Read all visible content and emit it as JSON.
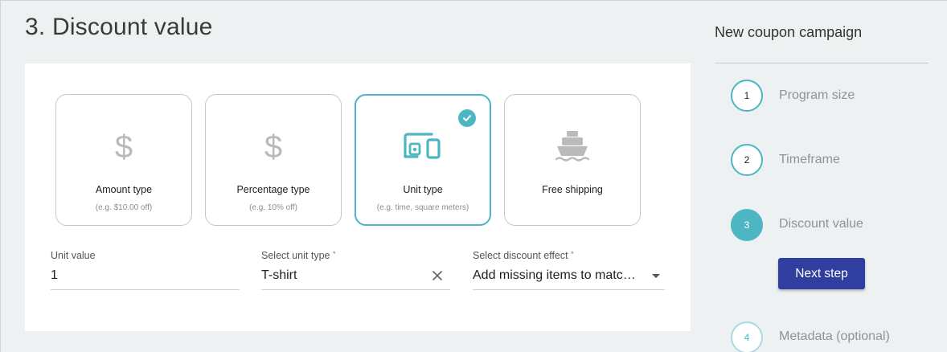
{
  "page": {
    "title": "3. Discount value"
  },
  "cards": [
    {
      "id": "amount",
      "icon": "dollar-icon",
      "glyph": "$",
      "title": "Amount type",
      "subtitle": "(e.g. $10.00 off)",
      "selected": false
    },
    {
      "id": "percentage",
      "icon": "dollar-icon",
      "glyph": "$",
      "title": "Percentage type",
      "subtitle": "(e.g. 10% off)",
      "selected": false
    },
    {
      "id": "unit",
      "icon": "devices-icon",
      "title": "Unit type",
      "subtitle": "(e.g. time, square meters)",
      "selected": true
    },
    {
      "id": "shipping",
      "icon": "ship-icon",
      "title": "Free shipping",
      "subtitle": "",
      "selected": false
    }
  ],
  "form": {
    "unit_value": {
      "label": "Unit value",
      "value": "1"
    },
    "unit_type": {
      "label": "Select unit type",
      "required_mark": "*",
      "value": "T-shirt"
    },
    "discount_effect": {
      "label": "Select discount effect",
      "required_mark": "*",
      "value": "Add missing items to matc…"
    }
  },
  "sidebar": {
    "title": "New coupon campaign",
    "steps": [
      {
        "number": "1",
        "label": "Program size",
        "state": "done"
      },
      {
        "number": "2",
        "label": "Timeframe",
        "state": "done"
      },
      {
        "number": "3",
        "label": "Discount value",
        "state": "active"
      },
      {
        "number": "4",
        "label": "Metadata (optional)",
        "state": "future"
      }
    ],
    "next_button": "Next step"
  },
  "colors": {
    "accent": "#4cb6c2",
    "primary_button": "#303f9f",
    "icon_gray": "#b8babb"
  }
}
